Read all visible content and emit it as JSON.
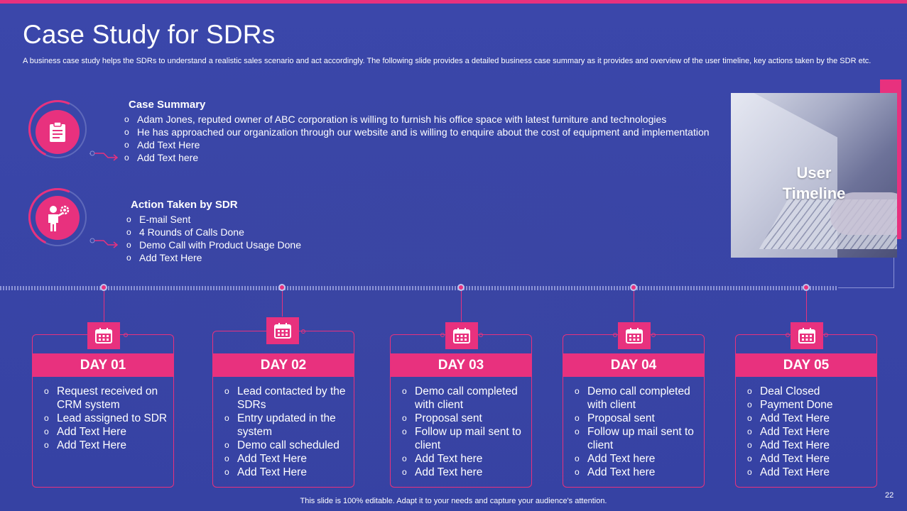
{
  "title": "Case Study for SDRs",
  "subtitle": "A business case study helps the SDRs to understand a realistic sales scenario and act accordingly. The following slide provides a detailed business case summary as it provides and overview of the user timeline, key actions taken by the SDR etc.",
  "case_summary": {
    "heading": "Case Summary",
    "icon": "clipboard-icon",
    "items": [
      "Adam Jones, reputed owner of ABC corporation is willing to furnish his office space with latest furniture and technologies",
      "He has approached our organization through our website and is willing to enquire about the cost of equipment and implementation",
      "Add Text Here",
      "Add Text here"
    ]
  },
  "action_taken": {
    "heading": "Action Taken by SDR",
    "icon": "person-gear-icon",
    "items": [
      "E-mail Sent",
      "4 Rounds of Calls Done",
      "Demo Call with Product Usage Done",
      "Add Text Here"
    ]
  },
  "user_timeline": {
    "label_line1": "User",
    "label_line2": "Timeline"
  },
  "days": [
    {
      "label": "DAY 01",
      "items": [
        "Request received on CRM system",
        "Lead assigned to SDR",
        "Add Text Here",
        "Add Text Here"
      ]
    },
    {
      "label": "DAY 02",
      "items": [
        "Lead contacted by the SDRs",
        "Entry updated in the system",
        "Demo call scheduled",
        "Add Text Here",
        "Add Text Here"
      ]
    },
    {
      "label": "DAY 03",
      "items": [
        "Demo call completed with client",
        "Proposal sent",
        "Follow up mail sent to client",
        "Add Text here",
        "Add Text here"
      ]
    },
    {
      "label": "DAY 04",
      "items": [
        "Demo call completed with client",
        "Proposal sent",
        "Follow up mail sent to client",
        "Add Text here",
        "Add Text here"
      ]
    },
    {
      "label": "DAY 05",
      "items": [
        "Deal Closed",
        "Payment Done",
        "Add Text Here",
        "Add Text Here",
        "Add Text Here",
        "Add Text Here",
        "Add Text Here"
      ]
    }
  ],
  "footer": "This slide is 100% editable. Adapt it to your needs and capture your audience's attention.",
  "page_number": "22",
  "colors": {
    "background": "#3a45a8",
    "accent": "#e8317e"
  }
}
